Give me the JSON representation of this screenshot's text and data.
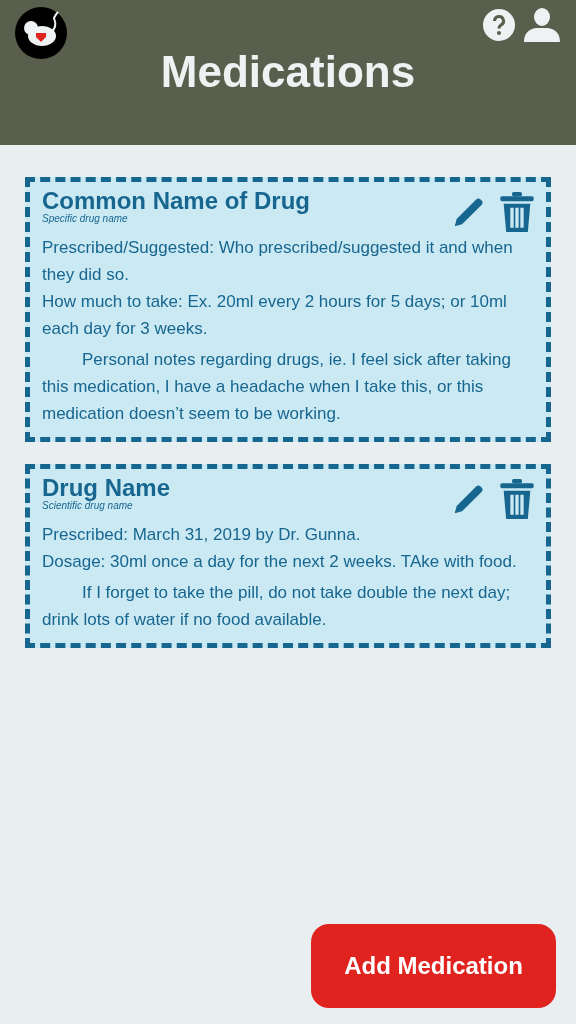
{
  "header": {
    "title": "Medications"
  },
  "cards": [
    {
      "name": "Common Name of Drug",
      "subname": "Specific drug name",
      "details": [
        "Prescribed/Suggested: Who prescribed/suggested it and when they did so.",
        "How much to take: Ex. 20ml every 2 hours for 5 days; or 10ml each day for 3 weeks."
      ],
      "notes": "Personal notes regarding drugs, ie. I feel sick after taking this medication, I have a headache when I take this, or this medication doesn’t seem to be working."
    },
    {
      "name": "Drug Name",
      "subname": "Scientific drug name",
      "details": [
        "Prescribed: March 31, 2019 by Dr. Gunna.",
        "Dosage: 30ml once a day for the next 2 weeks. TAke with food."
      ],
      "notes": "If I forget to take the pill, do not take double the next day; drink lots of water if no food available."
    }
  ],
  "add_button": "Add Medication"
}
